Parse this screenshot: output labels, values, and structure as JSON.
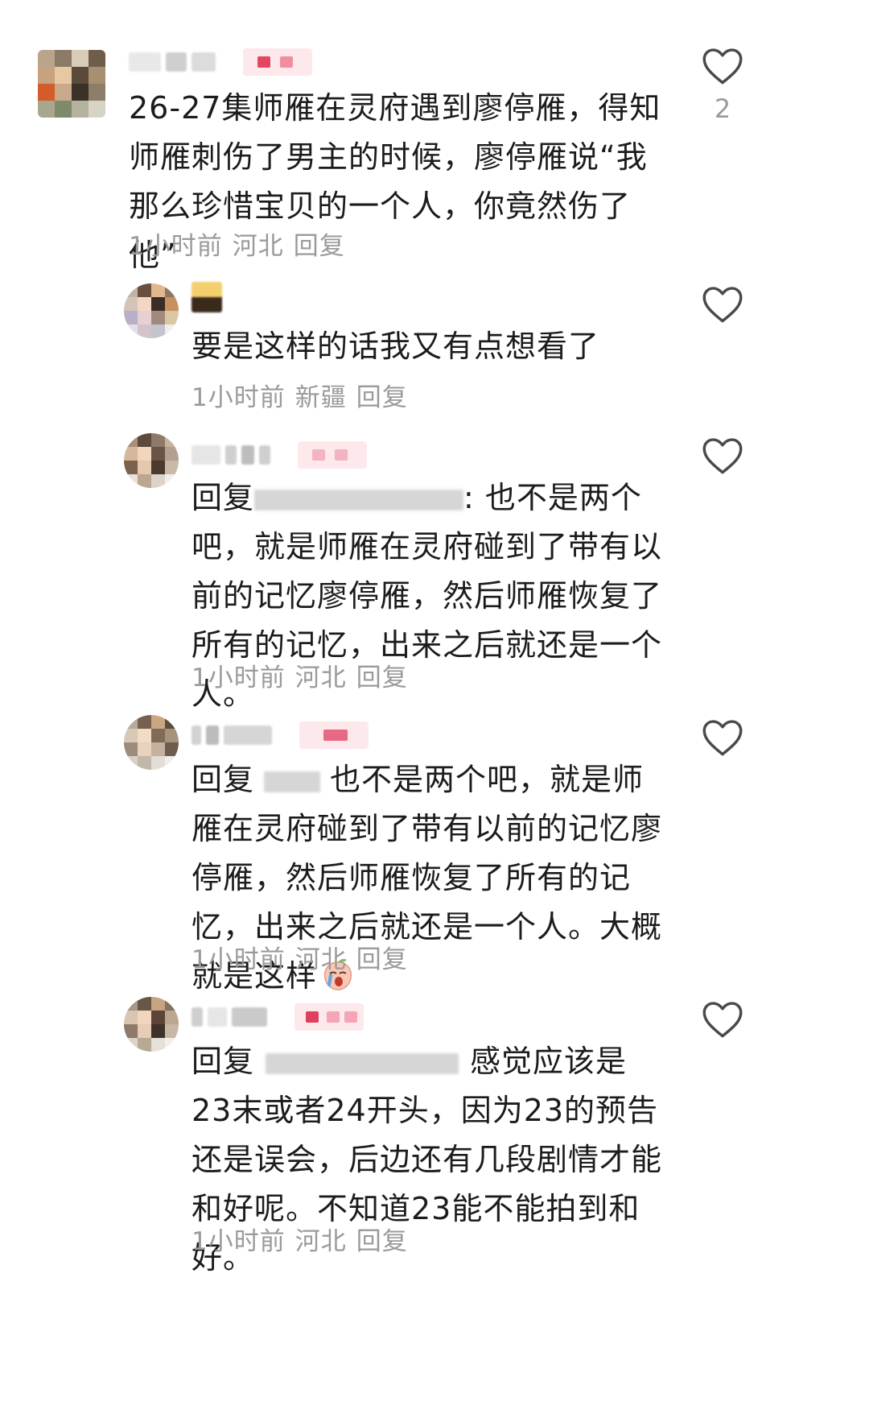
{
  "comments": [
    {
      "text": "26-27集师雁在灵府遇到廖停雁，得知师雁刺伤了男主的时候，廖停雁说“我那么珍惜宝贝的一个人，你竟然伤了他”",
      "time": "1小时前",
      "location": "河北",
      "reply_label": "回复",
      "like_count": "2"
    },
    {
      "text": "要是这样的话我又有点想看了",
      "time": "1小时前",
      "location": "新疆",
      "reply_label": "回复"
    },
    {
      "prefix": "回复",
      "text": ": 也不是两个吧，就是师雁在灵府碰到了带有以前的记忆廖停雁，然后师雁恢复了所有的记忆，出来之后就还是一个人。",
      "time": "1小时前",
      "location": "河北",
      "reply_label": "回复"
    },
    {
      "prefix": "回复",
      "text": "也不是两个吧，就是师雁在灵府碰到了带有以前的记忆廖停雁，然后师雁恢复了所有的记忆，出来之后就还是一个人。大概就是这样",
      "time": "1小时前",
      "location": "河北",
      "reply_label": "回复"
    },
    {
      "prefix": "回复",
      "text": "感觉应该是23末或者24开头，因为23的预告还是误会，后边还有几段剧情才能和好呢。不知道23能不能拍到和好。",
      "time": "1小时前",
      "location": "河北",
      "reply_label": "回复"
    }
  ],
  "icons": {
    "like": "heart-outline-icon",
    "emoji": "crying-peach-emoji-icon"
  },
  "colors": {
    "meta": "#9a9a9a",
    "badge": "#e44561",
    "text": "#1c1c1c"
  }
}
